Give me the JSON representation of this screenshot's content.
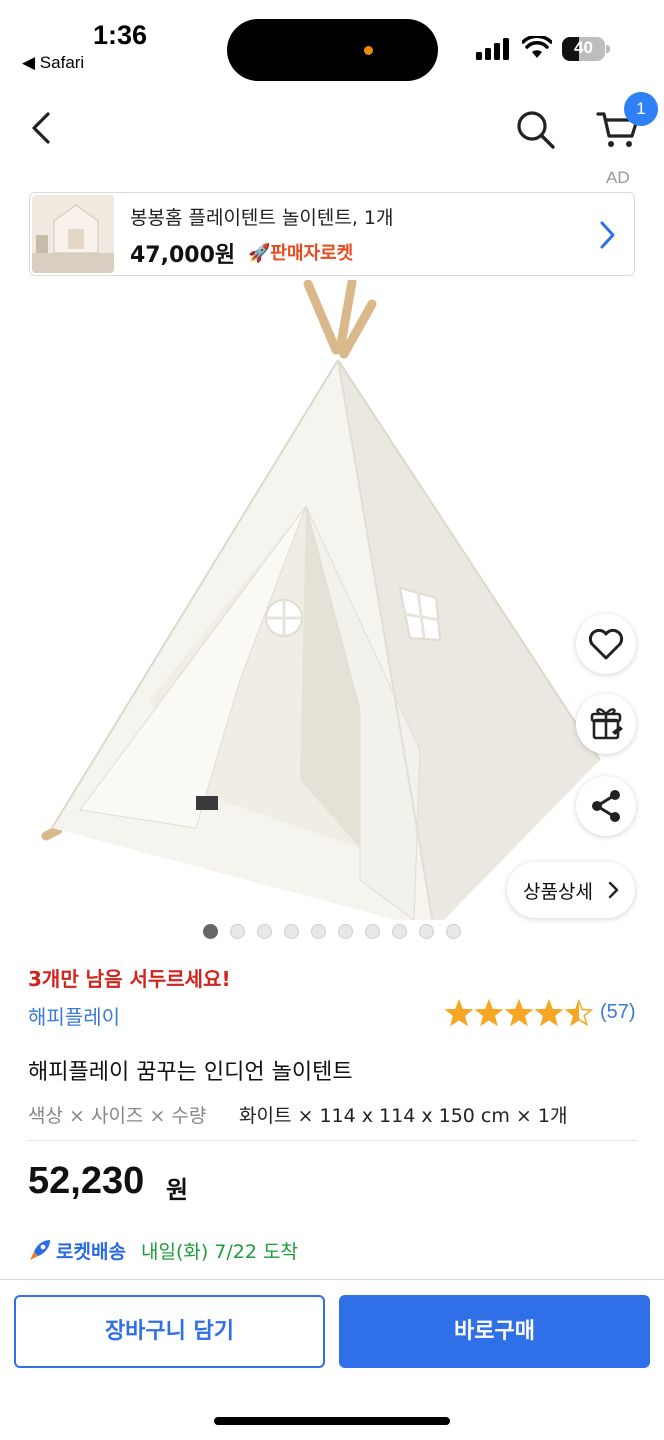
{
  "status_bar": {
    "time": "1:36",
    "back_app": "◀ Safari",
    "battery_level": "40",
    "battery_fraction": 0.4
  },
  "nav": {
    "cart_count": "1",
    "ad_label": "AD"
  },
  "ad_banner": {
    "title": "봉봉홈 플레이텐트 놀이텐트, 1개",
    "price": "47,000원",
    "badge": "🚀판매자로켓"
  },
  "product_image": {
    "image_count": 10,
    "current_index": 1,
    "detail_button": "상품상세"
  },
  "product": {
    "stock_warning": "3개만 남음 서두르세요!",
    "brand": "해피플레이",
    "rating": 4.5,
    "review_count": "(57)",
    "name": "해피플레이 꿈꾸는 인디언 놀이텐트",
    "options_label": "색상 × 사이즈 × 수량",
    "options_value": "화이트 × 114 x 114 x 150 cm × 1개",
    "price": "52,230",
    "price_unit": "원",
    "delivery_label": "로켓배송",
    "delivery_date": "내일(화) 7/22 도착"
  },
  "bottom_bar": {
    "cart_button": "장바구니 담기",
    "buy_button": "바로구매"
  },
  "colors": {
    "accent": "#2f6fe8",
    "warning": "#d2231c",
    "delivery": "#1e9c3b",
    "star": "#f5a623"
  },
  "icons": [
    "back-icon",
    "search-icon",
    "cart-icon",
    "heart-icon",
    "gift-icon",
    "share-icon",
    "chevron-right-icon",
    "rocket-icon",
    "star-icon"
  ]
}
